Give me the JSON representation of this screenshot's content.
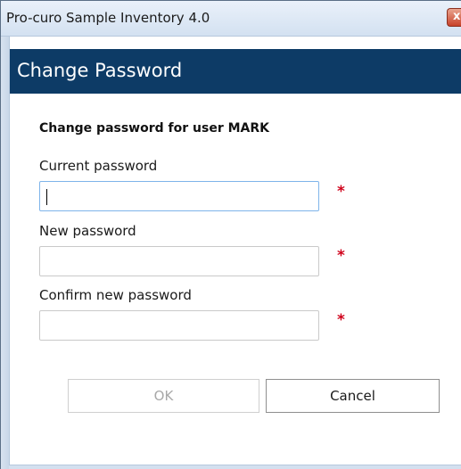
{
  "window": {
    "title": "Pro-curo Sample Inventory 4.0",
    "close_icon": "close-icon",
    "close_glyph": "x"
  },
  "dialog": {
    "heading": "Change Password",
    "subtitle": "Change password for user MARK"
  },
  "fields": {
    "current": {
      "label": "Current password",
      "value": "",
      "required_marker": "*"
    },
    "new": {
      "label": "New password",
      "value": "",
      "required_marker": "*"
    },
    "confirm": {
      "label": "Confirm new password",
      "value": "",
      "required_marker": "*"
    }
  },
  "buttons": {
    "ok_label": "OK",
    "ok_enabled": false,
    "cancel_label": "Cancel"
  },
  "colors": {
    "banner": "#0d3b66",
    "required": "#d0021b",
    "focus_border": "#7eb4ea"
  }
}
